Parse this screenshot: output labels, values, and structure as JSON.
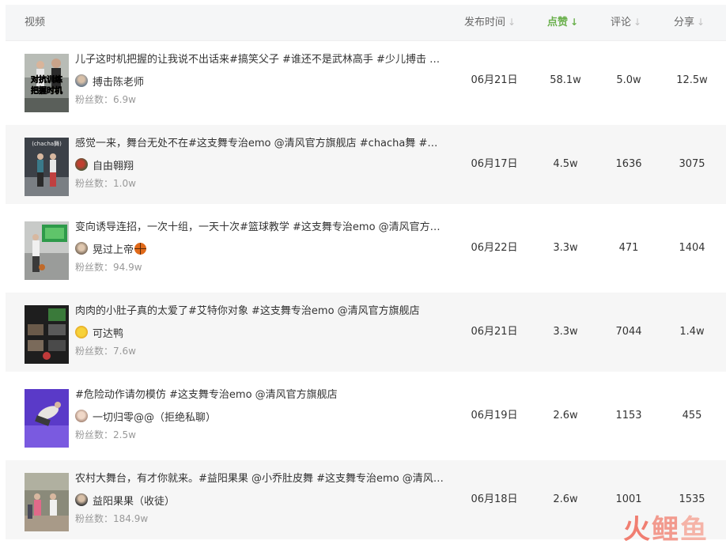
{
  "header": {
    "video_label": "视频",
    "time_label": "发布时间",
    "like_label": "点赞",
    "comment_label": "评论",
    "share_label": "分享",
    "arrow": "↓"
  },
  "rows": [
    {
      "title": "儿子这时机把握的让我说不出话来#搞笑父子 #谁还不是武林高手 #少儿搏击 #武术",
      "thumb_text_1": "对抗训练",
      "thumb_text_2": "把握时机",
      "author": "搏击陈老师",
      "fans_label": "粉丝数：",
      "fans": "6.9w",
      "time": "06月21日",
      "likes": "58.1w",
      "comments": "5.0w",
      "shares": "12.5w"
    },
    {
      "title": "感觉一来，舞台无处不在#这支舞专治emo @清风官方旗舰店 #chacha舞 #恰恰舞",
      "thumb_text_1": "(chacha舞)",
      "author": "自由翱翔",
      "fans_label": "粉丝数：",
      "fans": "1.0w",
      "time": "06月17日",
      "likes": "4.5w",
      "comments": "1636",
      "shares": "3075"
    },
    {
      "title": "变向诱导连招，一次十组，一天十次#篮球教学 #这支舞专治emo @清风官方旗舰店",
      "author": "晃过上帝",
      "fans_label": "粉丝数：",
      "fans": "94.9w",
      "time": "06月22日",
      "likes": "3.3w",
      "comments": "471",
      "shares": "1404"
    },
    {
      "title": "肉肉的小肚子真的太爱了#艾特你对象 #这支舞专治emo @清风官方旗舰店",
      "author": "可达鸭",
      "fans_label": "粉丝数：",
      "fans": "7.6w",
      "time": "06月21日",
      "likes": "3.3w",
      "comments": "7044",
      "shares": "1.4w"
    },
    {
      "title": "#危险动作请勿模仿 #这支舞专治emo @清风官方旗舰店",
      "author": "一切归零@@（拒绝私聊）",
      "fans_label": "粉丝数：",
      "fans": "2.5w",
      "time": "06月19日",
      "likes": "2.6w",
      "comments": "1153",
      "shares": "455"
    },
    {
      "title": "农村大舞台，有才你就来。#益阳果果 @小乔肚皮舞 #这支舞专治emo @清风官方旗舰店",
      "author": "益阳果果（收徒）",
      "fans_label": "粉丝数：",
      "fans": "184.9w",
      "time": "06月18日",
      "likes": "2.6w",
      "comments": "1001",
      "shares": "1535"
    }
  ],
  "watermark": {
    "c1": "火",
    "c2": "鲤",
    "c3": "鱼"
  },
  "colors": {
    "accent": "#6ab04c",
    "header_bg": "#f5f6f7",
    "alt_row_bg": "#f6f6f6"
  }
}
